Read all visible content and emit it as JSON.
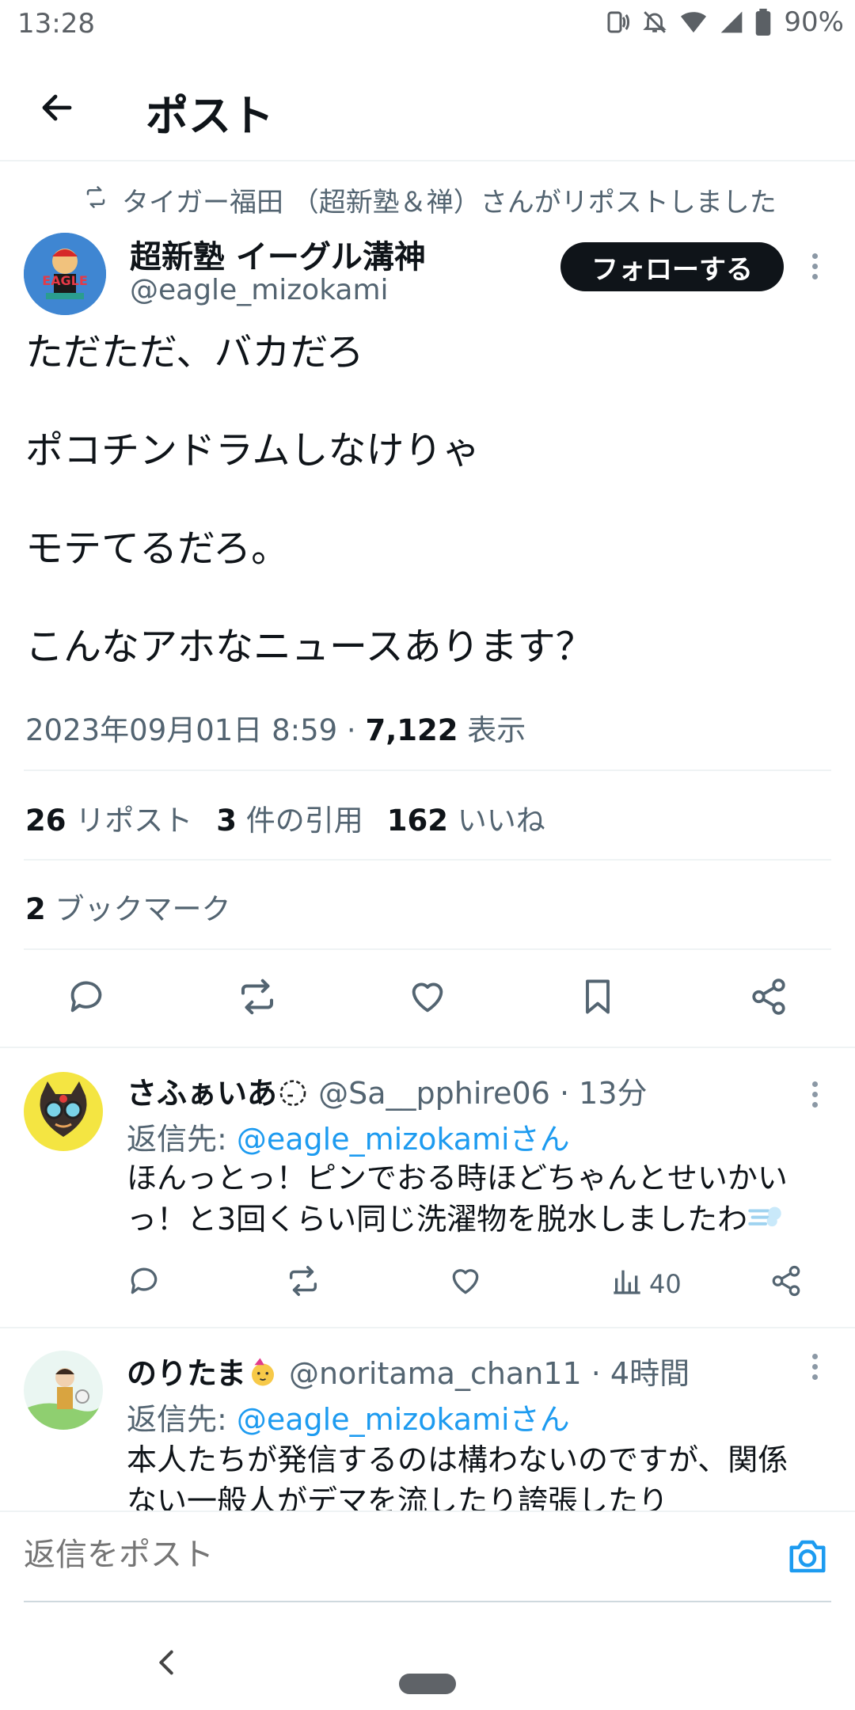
{
  "status_bar": {
    "time": "13:28",
    "battery": "90%"
  },
  "header": {
    "title": "ポスト"
  },
  "post": {
    "repost_line": "タイガー福田 （超新塾＆禅）さんがリポストしました",
    "author_name": "超新塾 イーグル溝神",
    "author_handle": "@eagle_mizokami",
    "follow_label": "フォローする",
    "paragraphs": [
      "ただただ、バカだろ",
      "ポコチンドラムしなけりゃ",
      "モテてるだろ。",
      "こんなアホなニュースあります？"
    ],
    "datetime": "2023年09月01日 8:59 · ",
    "views": "7,122",
    "views_label": " 表示",
    "reposts_count": "26",
    "reposts_label": " リポスト",
    "quotes_count": "3",
    "quotes_label": " 件の引用",
    "likes_count": "162",
    "likes_label": " いいね",
    "bookmarks_count": "2",
    "bookmarks_label": " ブックマーク"
  },
  "replies": [
    {
      "name": "さふぁいあ",
      "handle_time": " @Sa__pphire06 · 13分",
      "reply_to_label": "返信先: ",
      "reply_to_mention": "@eagle_mizokamiさん",
      "text": "ほんっとっ！ピンでおる時ほどちゃんとせいかいっ！と3回くらい同じ洗濯物を脱水しましたわ",
      "views": "40"
    },
    {
      "name": "のりたま",
      "handle_time": " @noritama_chan11 · 4時間",
      "reply_to_label": "返信先: ",
      "reply_to_mention": "@eagle_mizokamiさん",
      "text": "本人たちが発信するのは構わないのですが、関係ない一般人がデマを流したり誇張したり"
    }
  ],
  "composer": {
    "placeholder": "返信をポスト"
  },
  "icons": {
    "back": "arrow-left-icon",
    "repost": "repost-icon",
    "reply": "reply-icon",
    "like": "heart-icon",
    "bookmark": "bookmark-icon",
    "share": "share-icon",
    "views": "views-chart-icon",
    "camera": "camera-icon"
  },
  "colors": {
    "accent": "#1d9bf0",
    "text": "#0f1419",
    "secondary": "#536471"
  }
}
